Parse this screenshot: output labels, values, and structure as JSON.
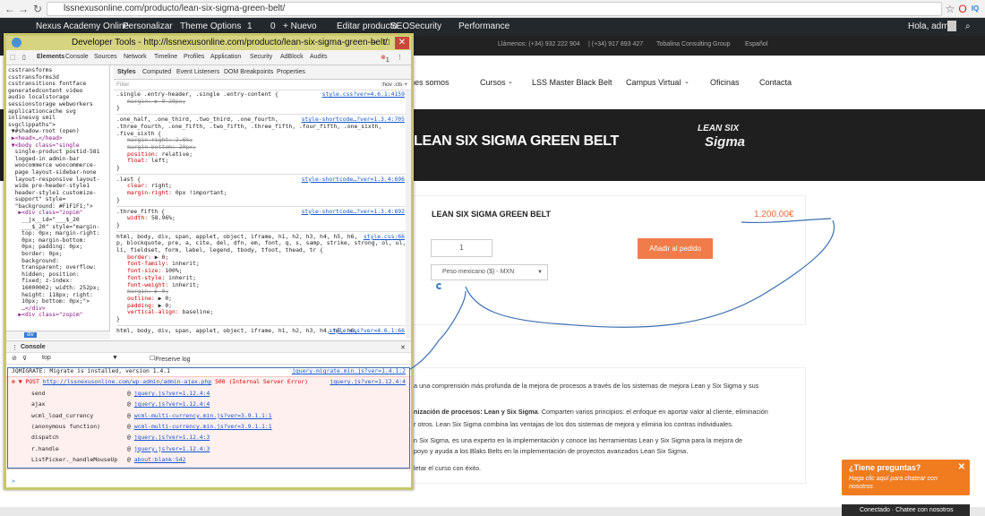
{
  "browser": {
    "url": "lssnexusonline.com/producto/lean-six-sigma-green-belt/"
  },
  "admin_bar": {
    "site": "Nexus Academy Online",
    "personalize": "Personalizar",
    "theme_options": "Theme Options",
    "updates": "1",
    "comments": "0",
    "new": "+ Nuevo",
    "edit": "Editar producto",
    "seo": "SEO",
    "security": "Security",
    "performance": "Performance",
    "greeting": "Hola, admin"
  },
  "topbar": {
    "call": "Llámenos: (+34) 932 222 904",
    "phone2": "| (+34) 917 893 427",
    "company": "Tobalina Consulting Group",
    "lang": "Español"
  },
  "nav": {
    "items": [
      "nes somos",
      "Cursos",
      "LSS Master Black Belt",
      "Campus Virtual",
      "Oficinas",
      "Contacta"
    ]
  },
  "hero": {
    "title": "LEAN SIX SIGMA GREEN BELT",
    "logo_line1": "LEAN SIX",
    "logo_line2": "Sigma"
  },
  "product": {
    "title": "LEAN SIX SIGMA GREEN BELT",
    "price": "1,200.00€",
    "qty": "1",
    "add_button": "Añadir al pedido",
    "currency": "Peso mexicano ($) - MXN"
  },
  "description": {
    "line1": "a una comprensión más profunda de la mejora de procesos a través de los sistemas de mejora Lean y Six Sigma y sus",
    "line2_bold": "nización de procesos: Lean y Six Sigma",
    "line2_rest": ". Comparten varios principios: el enfoque en aportar valor al cliente, eliminación",
    "line3": "r otros. Lean Six Sigma combina las ventajas de los dos sistemas de mejora y elimina los contras individuales.",
    "line4": "n Six Sigma, es una experto en la implementación y conoce las herramientas Lean y Six Sigma para la mejora de",
    "line5": "poyo y ayuda a los Blaks Belts en la implementación de proyectos avanzados Lean Six Sigma.",
    "line6": "letar el curso con éxito."
  },
  "chat": {
    "title": "¿Tiene preguntas?",
    "subtitle": "Haga clic aquí para chatear con nosotros",
    "status": "Conectado · Chatee con nosotros"
  },
  "devtools": {
    "title": "Developer Tools - http://lssnexusonline.com/producto/lean-six-sigma-green-belt/",
    "tabs": [
      "Elements",
      "Console",
      "Sources",
      "Network",
      "Timeline",
      "Profiles",
      "Application",
      "Security",
      "AdBlock",
      "Audits"
    ],
    "error_count": "1",
    "subtabs": [
      "Styles",
      "Computed",
      "Event Listeners",
      "DOM Breakpoints",
      "Properties"
    ],
    "filter_placeholder": "Filter",
    "filter_right": ":hov  .cls  +",
    "breadcrumb": "div",
    "console_tab": "Console",
    "console_context": "top",
    "preserve_log": "Preserve log",
    "elements_lines": [
      "csstransforms",
      "csstransforms3d",
      "csstransitions fontface",
      "generatedcontent video",
      "audio localstorage",
      "sessionstorage webworkers",
      "applicationcache svg",
      "inlinesvg smil",
      "svgclippaths\">",
      " ▼#shadow-root (open)",
      " ▶<head>…</head>",
      " ▼<body class=\"single",
      "  single-product postid-581",
      "  logged-in admin-bar",
      "  woocommerce woocommerce-",
      "  page layout-sidebar-none",
      "  layout-responsive layout-",
      "  wide pre-header-style1",
      "  header-style1 customize-",
      "  support\" style=",
      "  \"background: #F1F1F1;\">",
      "   ▶<div class=\"zopim\"",
      "    __jx__id=\"___$_20",
      "    ___$_20\" style=\"margin-",
      "    top: 0px; margin-right:",
      "    0px; margin-bottom:",
      "    0px; padding: 0px;",
      "    border: 0px;",
      "    background:",
      "    transparent; overflow:",
      "    hidden; position:",
      "    fixed; z-index:",
      "    16000002; width: 252px;",
      "    height: 118px; right:",
      "    10px; bottom: 0px;\">",
      "    …</div>",
      "   ▶<div class=\"zopim\""
    ],
    "rules": [
      {
        "sel": ".single .entry-header, .single .entry-content {",
        "link": "style.css?ver=4.6.1:4159",
        "props": [
          [
            "margin",
            "▶ 0 20px;",
            true
          ]
        ]
      },
      {
        "sel": ".one_half, .one_third, .two_third, .one_fourth,\n.three_fourth, .one_fifth, .two_fifth, .three_fifth, .four_fifth, .one_sixth,\n.five_sixth {",
        "link": "style-shortcode…?ver=1.3.4:705",
        "props": [
          [
            "margin-right",
            "2.6%;",
            true
          ],
          [
            "margin-bottom",
            "20px;",
            true
          ],
          [
            "position",
            "relative;",
            false
          ],
          [
            "float",
            "left;",
            false
          ]
        ]
      },
      {
        "sel": ".last {",
        "link": "style-shortcode…?ver=1.3.4:696",
        "props": [
          [
            "clear",
            "right;",
            false
          ],
          [
            "margin-right",
            "0px !important;",
            false
          ]
        ]
      },
      {
        "sel": ".three_fifth {",
        "link": "style-shortcode…?ver=1.3.4:692",
        "props": [
          [
            "width",
            "58.96%;",
            false
          ]
        ]
      },
      {
        "sel": "html, body, div, span, applet, object, iframe, h1, h2, h3, h4, h5, h6,\np, blockquote, pre, a, cite, del, dfn, em, font, q, s, samp, strike, strong, ol, ul,\nli, fieldset, form, label, legend, tbody, tfoot, thead, tr {",
        "link": "style.css:66",
        "props": [
          [
            "border",
            "▶ 0;",
            false
          ],
          [
            "font-family",
            "inherit;",
            false
          ],
          [
            "font-size",
            "100%;",
            false
          ],
          [
            "font-style",
            "inherit;",
            false
          ],
          [
            "font-weight",
            "inherit;",
            false
          ],
          [
            "margin",
            "▶ 0;",
            true
          ],
          [
            "outline",
            "▶ 0;",
            false
          ],
          [
            "padding",
            "▶ 0;",
            false
          ],
          [
            "vertical-align",
            "baseline;",
            false
          ]
        ]
      },
      {
        "sel": "html, body, div, span, applet, object, iframe, h1, h2, h3, h4, h5, h6,",
        "link": "style.css?ver=4.6.1:66",
        "props": []
      }
    ],
    "console": {
      "migrate": "JQMIGRATE: Migrate is installed, version 1.4.1",
      "migrate_src": "jquery-migrate.min.js?ver=1.4.1:2",
      "post_prefix": "▼ POST",
      "post_url": "http://lssnexusonline.com/wp-admin/admin-ajax.php",
      "post_status": "500 (Internal Server Error)",
      "post_src": "jquery.js?ver=1.12.4:4",
      "stack": [
        {
          "fn": "send",
          "src": "jquery.js?ver=1.12.4:4"
        },
        {
          "fn": "ajax",
          "src": "jquery.js?ver=1.12.4:4"
        },
        {
          "fn": "wcml_load_currency",
          "src": "wcml-multi-currency.min.js?ver=3.9.1.1:1"
        },
        {
          "fn": "(anonymous function)",
          "src": "wcml-multi-currency.min.js?ver=3.9.1.1:1"
        },
        {
          "fn": "dispatch",
          "src": "jquery.js?ver=1.12.4:3"
        },
        {
          "fn": "r.handle",
          "src": "jquery.js?ver=1.12.4:3"
        },
        {
          "fn": "ListPicker._handleMouseUp",
          "src": "about:blank:542"
        }
      ]
    }
  },
  "colors": {
    "accent": "#f07c4a",
    "price": "#e96a3c",
    "admin_bar": "#23282d",
    "devtools_frame": "#c8c66a",
    "annotation": "#3a6fb0"
  }
}
